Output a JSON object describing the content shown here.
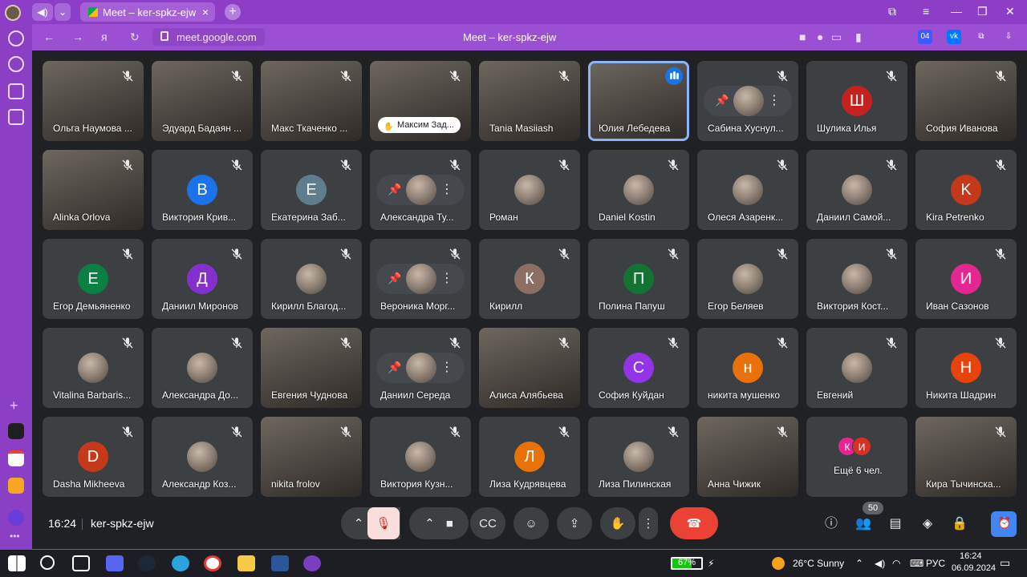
{
  "browser": {
    "tab_title": "Meet – ker-spkz-ejw",
    "address": "meet.google.com",
    "page_title": "Meet – ker-spkz-ejw",
    "ext_badge": "04"
  },
  "meeting": {
    "time": "16:24",
    "code": "ker-spkz-ejw",
    "people_count": "50"
  },
  "tiles": [
    {
      "name": "Ольга Наумова ...",
      "type": "video"
    },
    {
      "name": "Эдуард Бадаян ...",
      "type": "video"
    },
    {
      "name": "Макс Ткаченко ...",
      "type": "video"
    },
    {
      "name": "Максим Зад...",
      "type": "video"
    },
    {
      "name": "Tania Masiiash",
      "type": "video"
    },
    {
      "name": "Юлия Лебедева",
      "type": "video"
    },
    {
      "name": "Сабина Хуснул...",
      "type": "hover"
    },
    {
      "name": "Шулика Илья",
      "type": "letter",
      "letter": "Ш",
      "color": "#c5221f"
    },
    {
      "name": "София Иванова",
      "type": "video"
    },
    {
      "name": "Alinka Orlova",
      "type": "video"
    },
    {
      "name": "Виктория Крив...",
      "type": "letter",
      "letter": "В",
      "color": "#1a73e8"
    },
    {
      "name": "Екатерина Заб...",
      "type": "letter",
      "letter": "Е",
      "color": "#5f7d8c"
    },
    {
      "name": "Александра Ту...",
      "type": "hover"
    },
    {
      "name": "Роман",
      "type": "photo"
    },
    {
      "name": "Daniel Kostin",
      "type": "photo"
    },
    {
      "name": "Олеся Азаренк...",
      "type": "photo"
    },
    {
      "name": "Даниил Самой...",
      "type": "photo"
    },
    {
      "name": "Kira Petrenko",
      "type": "letter",
      "letter": "K",
      "color": "#c5391a"
    },
    {
      "name": "Егор Демьяненко",
      "type": "letter",
      "letter": "Е",
      "color": "#0b8043"
    },
    {
      "name": "Даниил Миронов",
      "type": "letter",
      "letter": "Д",
      "color": "#8430ce"
    },
    {
      "name": "Кирилл Благод...",
      "type": "photo"
    },
    {
      "name": "Вероника Морг...",
      "type": "hover"
    },
    {
      "name": "Кирилл",
      "type": "letter",
      "letter": "К",
      "color": "#8d6e63"
    },
    {
      "name": "Полина Папуш",
      "type": "letter",
      "letter": "П",
      "color": "#137333"
    },
    {
      "name": "Егор Беляев",
      "type": "photo"
    },
    {
      "name": "Виктория Кост...",
      "type": "photo"
    },
    {
      "name": "Иван Сазонов",
      "type": "letter",
      "letter": "И",
      "color": "#e52592"
    },
    {
      "name": "Vitalina Barbaris...",
      "type": "photo"
    },
    {
      "name": "Александра До...",
      "type": "photo"
    },
    {
      "name": "Евгения Чуднова",
      "type": "video"
    },
    {
      "name": "Даниил Середа",
      "type": "hover"
    },
    {
      "name": "Алиса Алябьева",
      "type": "video"
    },
    {
      "name": "София Куйдан",
      "type": "letter",
      "letter": "С",
      "color": "#9334e6"
    },
    {
      "name": "никита мушенко",
      "type": "letter",
      "letter": "н",
      "color": "#e8710a"
    },
    {
      "name": "Евгений",
      "type": "photo"
    },
    {
      "name": "Никита Шадрин",
      "type": "letter",
      "letter": "Н",
      "color": "#e8430a"
    },
    {
      "name": "Dasha Mikheeva",
      "type": "letter",
      "letter": "D",
      "color": "#c5391a"
    },
    {
      "name": "Александр Коз...",
      "type": "photo"
    },
    {
      "name": "nikita frolov",
      "type": "video"
    },
    {
      "name": "Виктория Кузн...",
      "type": "photo"
    },
    {
      "name": "Лиза Кудрявцева",
      "type": "letter",
      "letter": "Л",
      "color": "#e8710a"
    },
    {
      "name": "Лиза Пилинская",
      "type": "photo"
    },
    {
      "name": "Анна Чижик",
      "type": "video"
    },
    {
      "name": "Ещё 6 чел.",
      "type": "more",
      "letters": [
        "К",
        "И"
      ]
    },
    {
      "name": "Кира Тычинска...",
      "type": "video"
    }
  ],
  "taskbar": {
    "battery": "67%",
    "battery_level": 0.67,
    "weather": "26°C  Sunny",
    "lang": "РУС",
    "time": "16:24",
    "date": "06.09.2024"
  }
}
